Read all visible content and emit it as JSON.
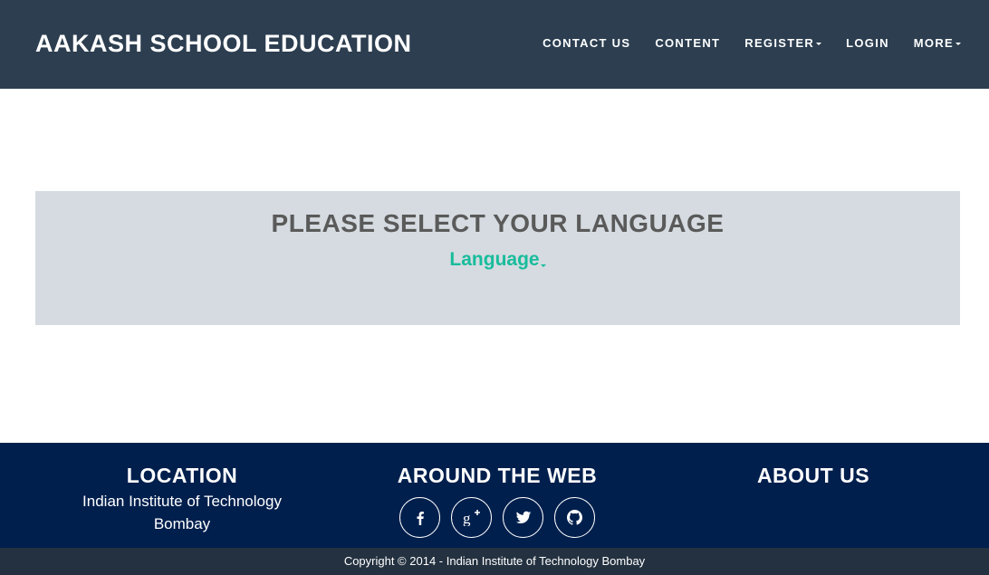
{
  "navbar": {
    "brand": "AAKASH SCHOOL EDUCATION",
    "items": [
      {
        "label": "CONTACT US",
        "dropdown": false
      },
      {
        "label": "CONTENT",
        "dropdown": false
      },
      {
        "label": "REGISTER",
        "dropdown": true
      },
      {
        "label": "LOGIN",
        "dropdown": false
      },
      {
        "label": "MORE",
        "dropdown": true
      }
    ]
  },
  "main": {
    "heading": "PLEASE SELECT YOUR LANGUAGE",
    "language_dropdown": "Language"
  },
  "footer": {
    "location": {
      "title": "LOCATION",
      "line1": "Indian Institute of Technology",
      "line2": "Bombay"
    },
    "web": {
      "title": "AROUND THE WEB",
      "icons": [
        "facebook-icon",
        "google-plus-icon",
        "twitter-icon",
        "github-icon"
      ]
    },
    "about": {
      "title": "ABOUT US"
    },
    "copyright": "Copyright © 2014 - Indian Institute of Technology Bombay"
  },
  "colors": {
    "navbar": "#2c3e50",
    "accent": "#18bc9c",
    "panel": "#d5dbe0",
    "footer": "#001f4d",
    "copyright_bar": "#233140"
  }
}
